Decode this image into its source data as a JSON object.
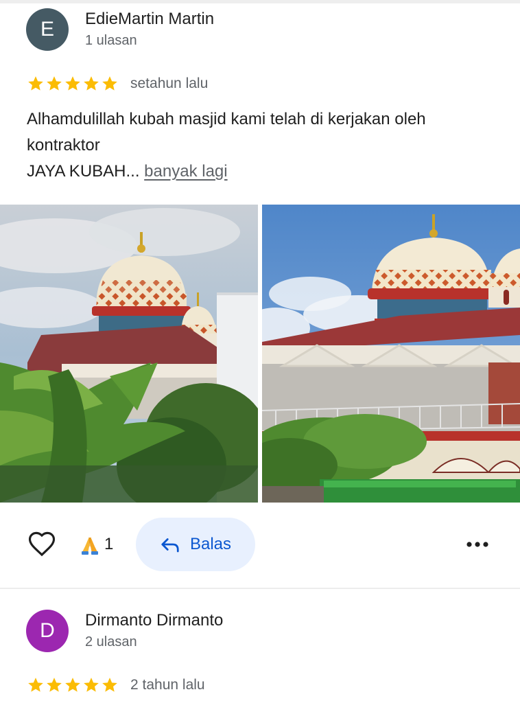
{
  "reviews": [
    {
      "avatar_initial": "E",
      "avatar_color": "#455a64",
      "author": "EdieMartin Martin",
      "review_count": "1 ulasan",
      "rating": 5,
      "date": "setahun lalu",
      "text_lines": [
        "Alhamdulillah kubah masjid kami  telah di kerjakan oleh",
        "kontraktor",
        "JAYA KUBAH..."
      ],
      "more_label": "banyak lagi",
      "reaction_emoji": "folded-hands",
      "reaction_count": "1",
      "reply_label": "Balas"
    },
    {
      "avatar_initial": "D",
      "avatar_color": "#9c27b0",
      "author": "Dirmanto Dirmanto",
      "review_count": "2 ulasan",
      "rating": 5,
      "date": "2 tahun lalu"
    }
  ],
  "icons": {
    "star": "star-icon",
    "like": "heart-outline-icon",
    "reply": "reply-arrow-icon",
    "more": "more-horizontal-icon"
  },
  "colors": {
    "star": "#fbbc04",
    "reply_bg": "#e8f0fe",
    "reply_text": "#0b57d0"
  }
}
